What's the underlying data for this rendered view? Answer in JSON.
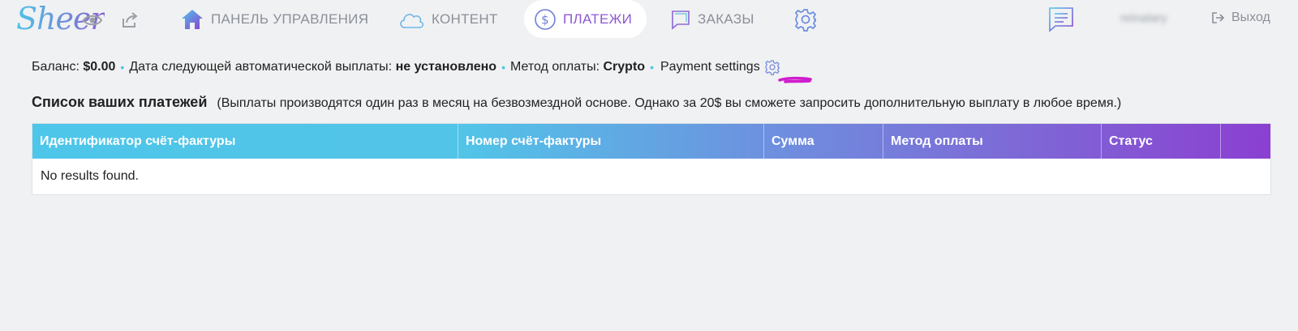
{
  "brand": {
    "logo_text": "Sheer"
  },
  "nav": {
    "items": [
      {
        "label": "ПАНЕЛЬ УПРАВЛЕНИЯ",
        "icon": "home-icon"
      },
      {
        "label": "КОНТЕНТ",
        "icon": "cloud-icon"
      },
      {
        "label": "ПЛАТЕЖИ",
        "icon": "dollar-icon",
        "active": true
      },
      {
        "label": "ЗАКАЗЫ",
        "icon": "orders-icon"
      }
    ],
    "username": "reinalary",
    "logout_label": "Выход",
    "icons": [
      "eye-icon",
      "share-icon",
      "settings-icon",
      "messages-icon",
      "logout-icon"
    ]
  },
  "info": {
    "balance_label": "Баланс:",
    "balance_value": "$0.00",
    "next_payout_label": "Дата следующей автоматической выплаты:",
    "next_payout_value": "не установлено",
    "method_label": "Метод оплаты:",
    "method_value": "Crypto",
    "settings_link": "Payment settings"
  },
  "section": {
    "title": "Список ваших платежей",
    "note": "(Выплаты производятся один раз в месяц на безвозмездной основе. Однако за 20$ вы сможете запросить дополнительную выплату в любое время.)"
  },
  "table": {
    "columns": [
      "Идентификатор счёт-фактуры",
      "Номер счёт-фактуры",
      "Сумма",
      "Метод оплаты",
      "Статус",
      ""
    ],
    "empty_text": "No results found."
  },
  "colors": {
    "accent_blue": "#4ec6e9",
    "accent_purple": "#8b3fd1",
    "active_nav": "#8c59cf",
    "annotation_magenta": "#d01ccd"
  }
}
